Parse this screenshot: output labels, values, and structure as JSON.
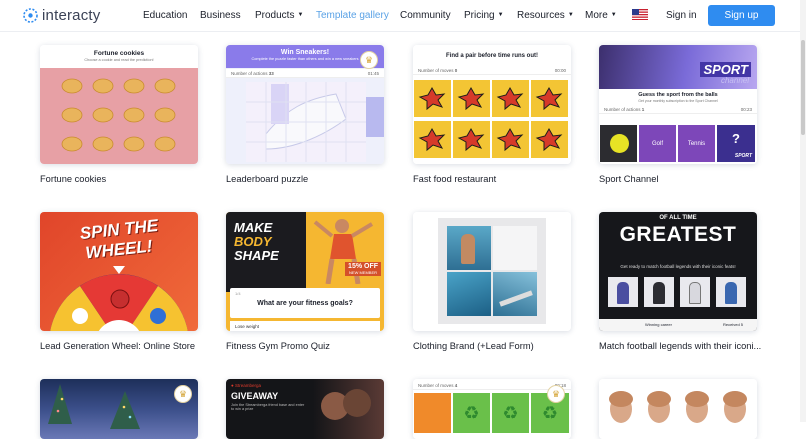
{
  "header": {
    "logo_text": "interacty",
    "nav": [
      {
        "label": "Education",
        "caret": false,
        "active": false
      },
      {
        "label": "Business",
        "caret": false,
        "active": false
      },
      {
        "label": "Products",
        "caret": true,
        "active": false
      },
      {
        "label": "Template gallery",
        "caret": false,
        "active": true
      },
      {
        "label": "Community",
        "caret": false,
        "active": false
      },
      {
        "label": "Pricing",
        "caret": true,
        "active": false
      },
      {
        "label": "Resources",
        "caret": true,
        "active": false
      },
      {
        "label": "More",
        "caret": true,
        "active": false
      }
    ],
    "signin_label": "Sign in",
    "signup_label": "Sign up"
  },
  "cards": [
    {
      "title": "Fortune cookies",
      "inner_title": "Fortune cookies",
      "inner_subtitle": "Choose a cookie and read the prediction!"
    },
    {
      "title": "Leaderboard puzzle",
      "inner_title": "Win Sneakers!",
      "inner_subtitle": "Complete the puzzle faster than others and win a new sneakers",
      "moves_label": "Number of actions",
      "moves_value": "33",
      "time": "01:45"
    },
    {
      "title": "Fast food restaurant",
      "inner_title": "Find a pair before time runs out!",
      "moves_label": "Number of moves",
      "moves_value": "0",
      "time": "00:00"
    },
    {
      "title": "Sport Channel",
      "inner_title": "Guess the sport from the balls",
      "inner_subtitle": "Get your monthly subscription to the Sport Channel",
      "moves_label": "Number of actions",
      "moves_value": "1",
      "time": "00:23",
      "banner_word": "SPORT",
      "banner_sub": "channel",
      "options": [
        "Golf",
        "Tennis",
        "?"
      ],
      "option_logo": "SPORT"
    },
    {
      "title": "Lead Generation Wheel: Online Store",
      "wheel_line1": "SPIN THE",
      "wheel_line2": "WHEEL!"
    },
    {
      "title": "Fitness Gym Promo Quiz",
      "promo_line1": "MAKE",
      "promo_line2": "BODY",
      "promo_line3": "SHAPE",
      "promo_badge": "15% OFF",
      "promo_badge_sub": "NEW MEMBER",
      "question": "What are your fitness goals?",
      "answer": "Lose weight",
      "qnum": "1/4"
    },
    {
      "title": "Clothing Brand (+Lead Form)"
    },
    {
      "title": "Match football legends with their iconi...",
      "top_small": "OF ALL TIME",
      "big": "GREATEST",
      "subtitle": "Get ready to match football legends with their iconic feats!",
      "labels": [
        "Winning career",
        "Received 5"
      ]
    },
    {
      "title": "",
      "note": "partially visible"
    },
    {
      "title": "",
      "tag": "Streamberga",
      "big": "GIVEAWAY",
      "sub": "Join the Streamberga friend base and enter to win a prize"
    },
    {
      "title": "",
      "moves_label": "Number of moves",
      "moves_value": "4",
      "time": "00:18"
    },
    {
      "title": ""
    }
  ],
  "colors": {
    "accent": "#2f8cf0",
    "active_nav": "#5aa2e6"
  }
}
